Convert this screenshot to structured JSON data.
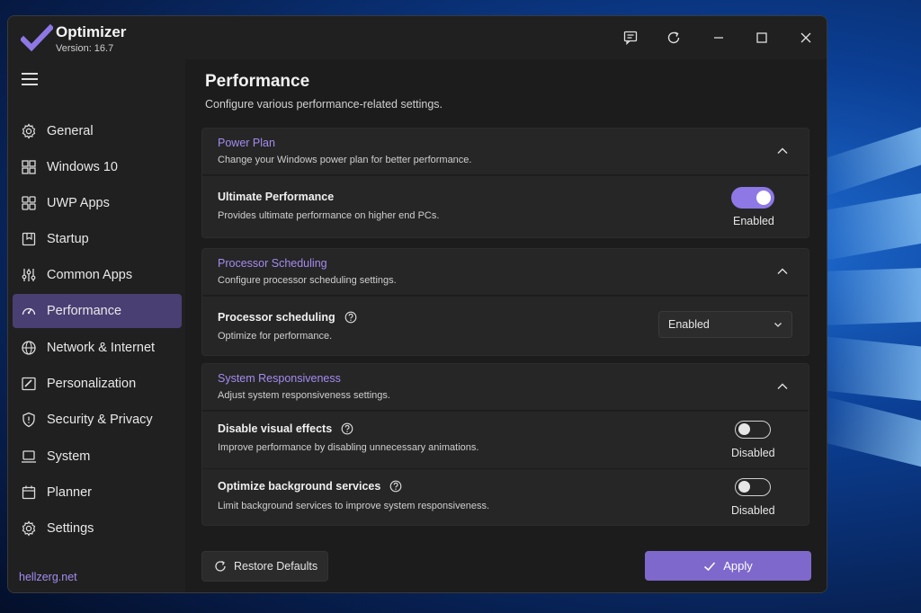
{
  "app": {
    "title": "Optimizer",
    "version": "Version: 16.7"
  },
  "titlebar": {
    "icons": [
      "feedback-icon",
      "refresh-icon",
      "minimize-icon",
      "maximize-icon",
      "close-icon"
    ]
  },
  "sidebar": {
    "items": [
      {
        "label": "General",
        "icon": "gear-icon",
        "active": false
      },
      {
        "label": "Windows 10",
        "icon": "windows-icon",
        "active": false
      },
      {
        "label": "UWP Apps",
        "icon": "apps-grid-icon",
        "active": false
      },
      {
        "label": "Startup",
        "icon": "startup-icon",
        "active": false
      },
      {
        "label": "Common Apps",
        "icon": "sliders-icon",
        "active": false
      },
      {
        "label": "Performance",
        "icon": "speedometer-icon",
        "active": true
      },
      {
        "label": "Network & Internet",
        "icon": "globe-icon",
        "active": false
      },
      {
        "label": "Personalization",
        "icon": "brush-icon",
        "active": false
      },
      {
        "label": "Security & Privacy",
        "icon": "shield-icon",
        "active": false
      },
      {
        "label": "System",
        "icon": "laptop-icon",
        "active": false
      },
      {
        "label": "Planner",
        "icon": "calendar-icon",
        "active": false
      },
      {
        "label": "Settings",
        "icon": "gear-icon",
        "active": false
      }
    ],
    "footer": "hellzerg.net"
  },
  "main": {
    "title": "Performance",
    "description": "Configure various performance-related settings.",
    "sections": [
      {
        "title": "Power Plan",
        "subtitle": "Change your Windows power plan for better performance.",
        "rows": [
          {
            "title": "Ultimate Performance",
            "subtitle": "Provides ultimate performance on higher end PCs.",
            "control": "toggle",
            "on": true,
            "state_label": "Enabled",
            "help": false
          }
        ]
      },
      {
        "title": "Processor Scheduling",
        "subtitle": "Configure processor scheduling settings.",
        "rows": [
          {
            "title": "Processor scheduling",
            "subtitle": "Optimize for performance.",
            "control": "select",
            "value": "Enabled",
            "help": true
          }
        ]
      },
      {
        "title": "System Responsiveness",
        "subtitle": "Adjust system responsiveness settings.",
        "rows": [
          {
            "title": "Disable visual effects",
            "subtitle": "Improve performance by disabling unnecessary animations.",
            "control": "toggle",
            "on": false,
            "state_label": "Disabled",
            "help": true
          },
          {
            "title": "Optimize background services",
            "subtitle": "Limit background services to improve system responsiveness.",
            "control": "toggle",
            "on": false,
            "state_label": "Disabled",
            "help": true
          }
        ]
      }
    ]
  },
  "footer": {
    "restore_label": "Restore Defaults",
    "apply_label": "Apply"
  },
  "colors": {
    "accent": "#7e68cc",
    "accent_text": "#a58bf0",
    "active_nav": "#4a3f73"
  }
}
